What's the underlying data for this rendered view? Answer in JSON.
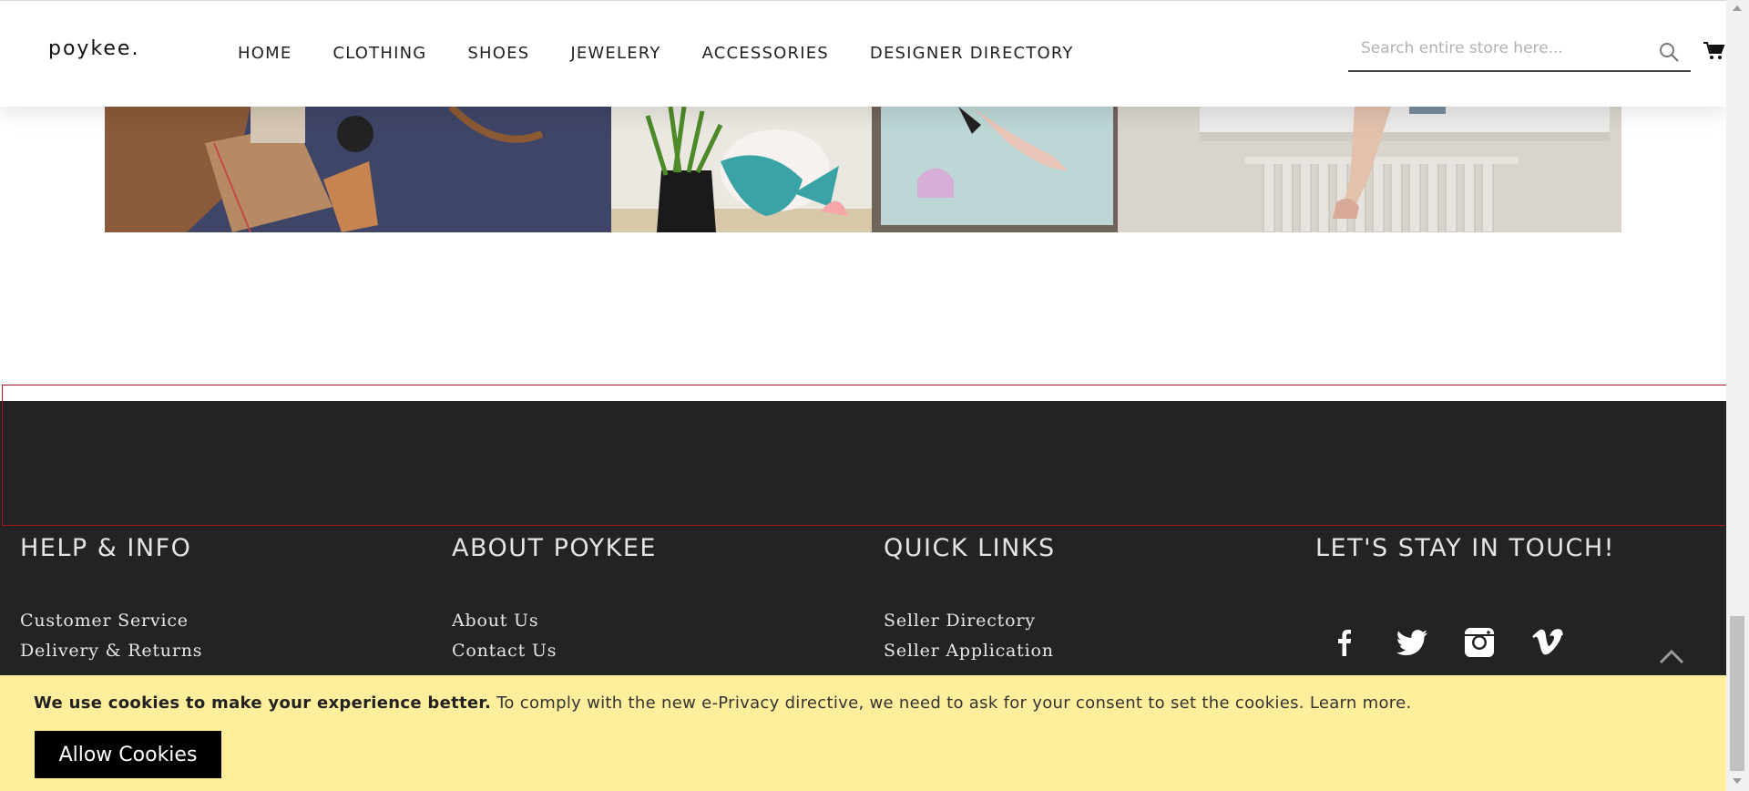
{
  "header": {
    "logo": "poykee.",
    "nav": [
      "HOME",
      "CLOTHING",
      "SHOES",
      "JEWELERY",
      "ACCESSORIES",
      "DESIGNER DIRECTORY"
    ],
    "search_placeholder": "Search entire store here...",
    "search_icon": "search-icon",
    "cart_icon": "cart-icon"
  },
  "footer": {
    "help": {
      "title": "HELP & INFO",
      "links": [
        "Customer Service",
        "Delivery & Returns"
      ]
    },
    "about": {
      "title": "ABOUT POYKEE",
      "links": [
        "About Us",
        "Contact Us"
      ]
    },
    "quick": {
      "title": "QUICK LINKS",
      "links": [
        "Seller Directory",
        "Seller Application"
      ]
    },
    "touch": {
      "title": "LET'S STAY IN TOUCH!",
      "social": [
        "facebook-icon",
        "twitter-icon",
        "instagram-icon",
        "vimeo-icon"
      ]
    }
  },
  "cookie": {
    "bold": "We use cookies to make your experience better.",
    "text": " To comply with the new e-Privacy directive, we need to ask for your consent to set the cookies.",
    "learn_more": "Learn more.",
    "button": "Allow Cookies"
  },
  "colors": {
    "footer_bg": "#232323",
    "cookie_bg": "#ffee9c",
    "highlight": "#a31818"
  }
}
